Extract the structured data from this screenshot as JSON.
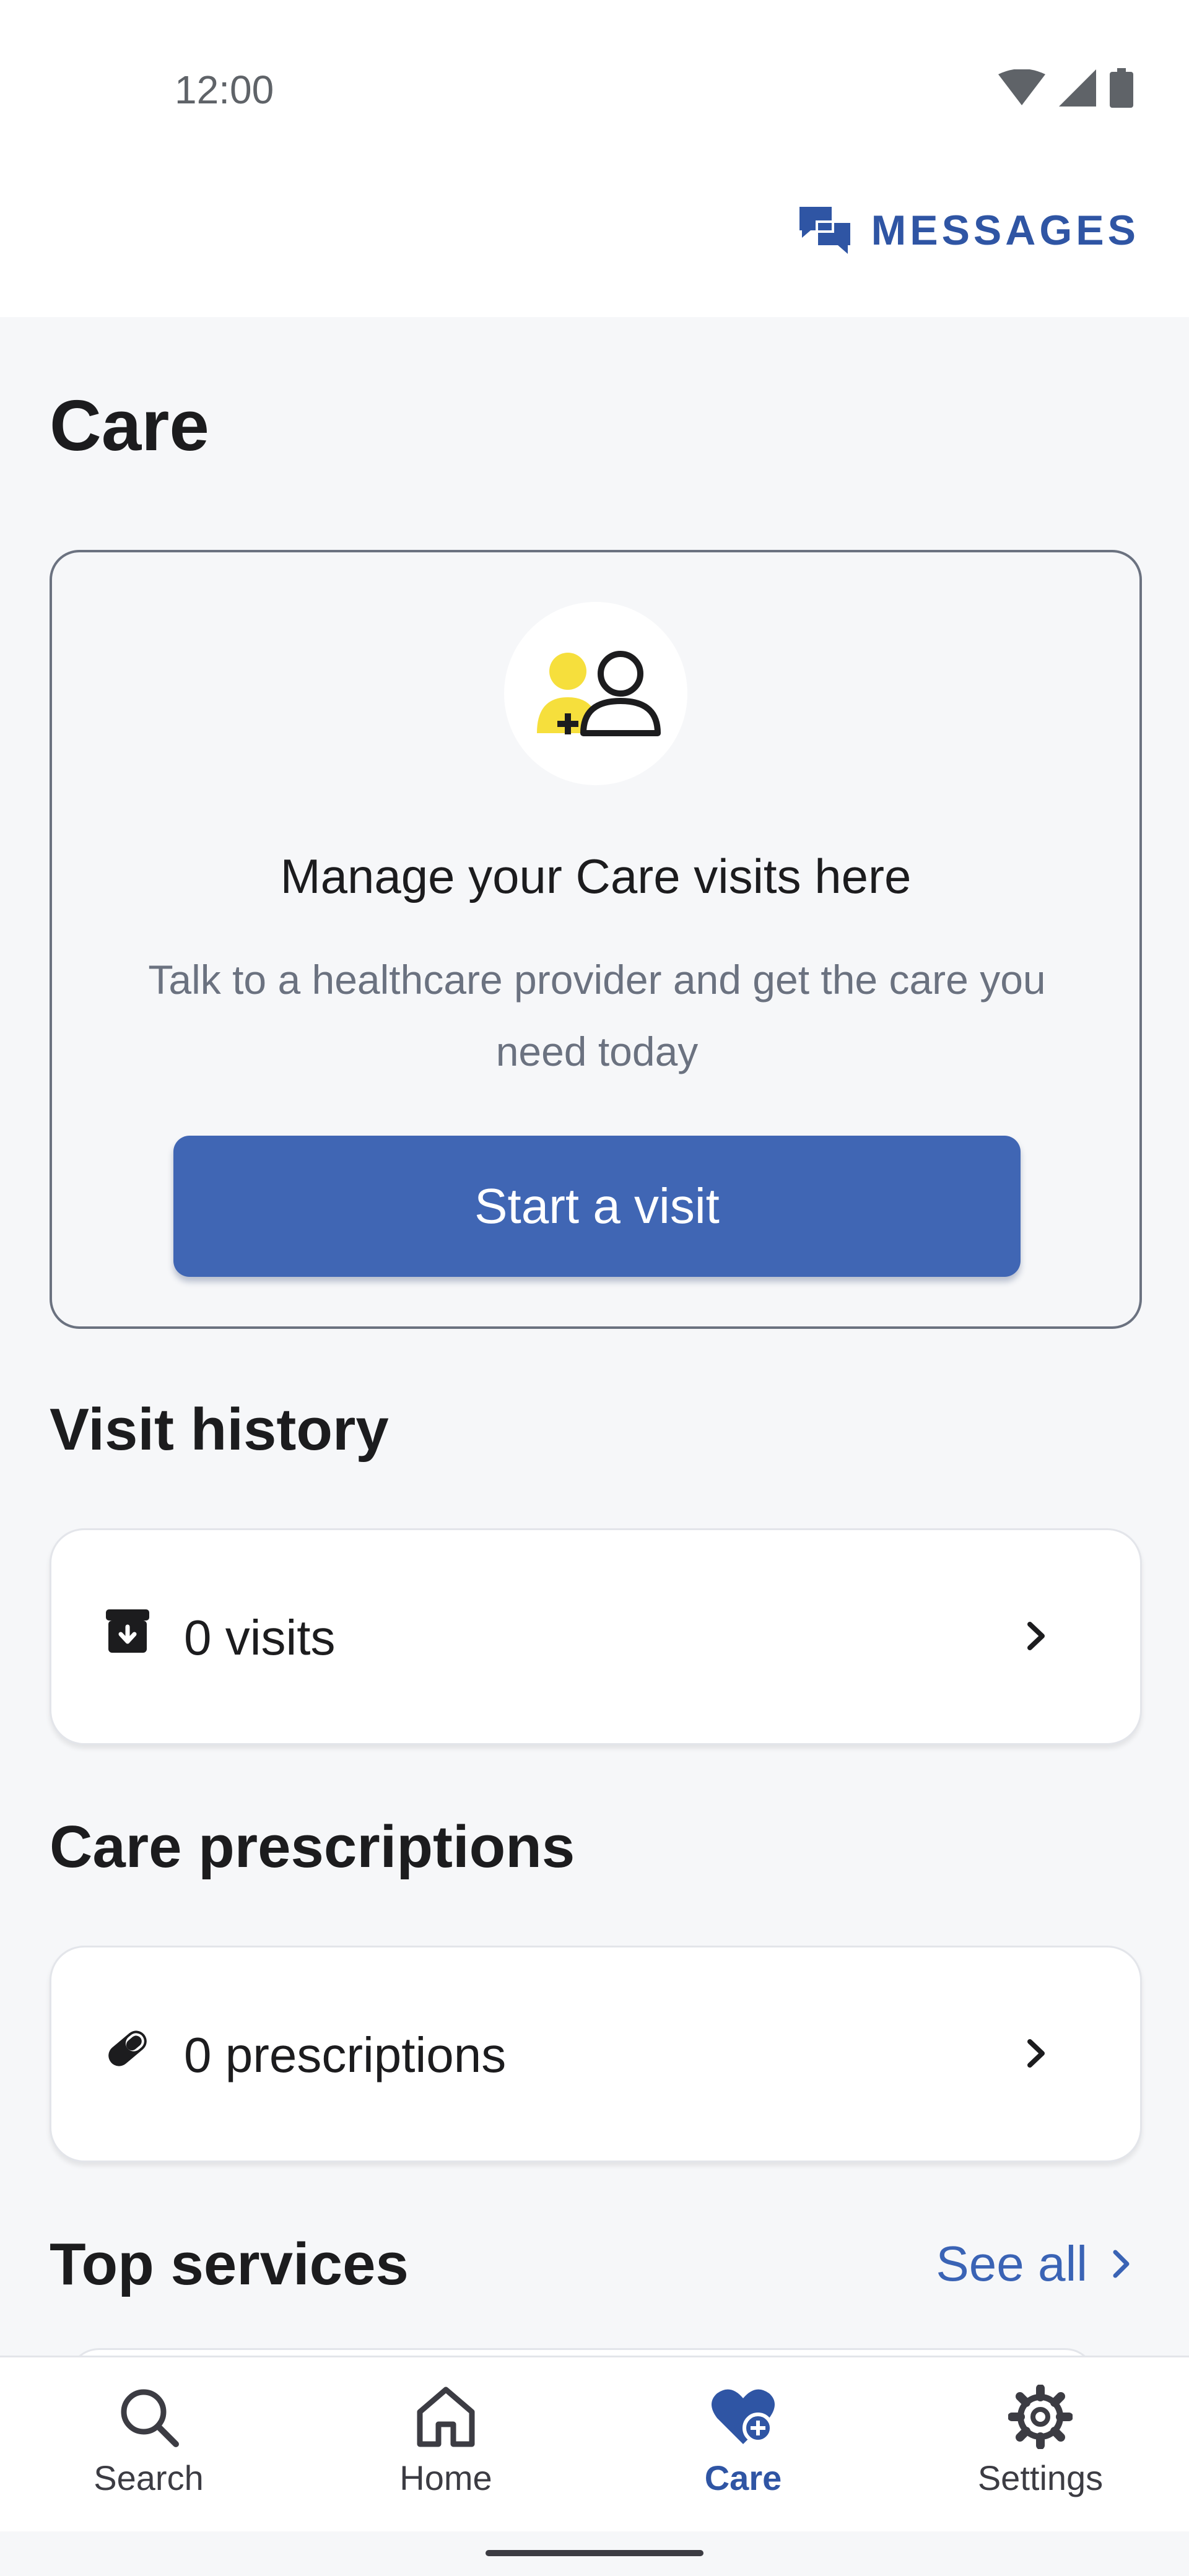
{
  "status_bar": {
    "time": "12:00"
  },
  "header": {
    "messages_label": "MESSAGES"
  },
  "page": {
    "title": "Care"
  },
  "promo": {
    "title": "Manage your Care visits here",
    "description": "Talk to a healthcare provider and get the care you need today",
    "button_label": "Start a visit"
  },
  "visit_history": {
    "title": "Visit history",
    "item_label": "0 visits"
  },
  "care_prescriptions": {
    "title": "Care prescriptions",
    "item_label": "0 prescriptions"
  },
  "top_services": {
    "title": "Top services",
    "see_all_label": "See all"
  },
  "bottom_nav": {
    "items": [
      {
        "label": "Search",
        "icon": "search-icon"
      },
      {
        "label": "Home",
        "icon": "home-icon"
      },
      {
        "label": "Care",
        "icon": "heart-plus-icon",
        "active": true
      },
      {
        "label": "Settings",
        "icon": "gear-icon"
      }
    ]
  },
  "colors": {
    "accent": "#2f55a4",
    "button": "#4066b4",
    "avatar_yellow": "#f6df3c",
    "background": "#f6f7f9"
  }
}
